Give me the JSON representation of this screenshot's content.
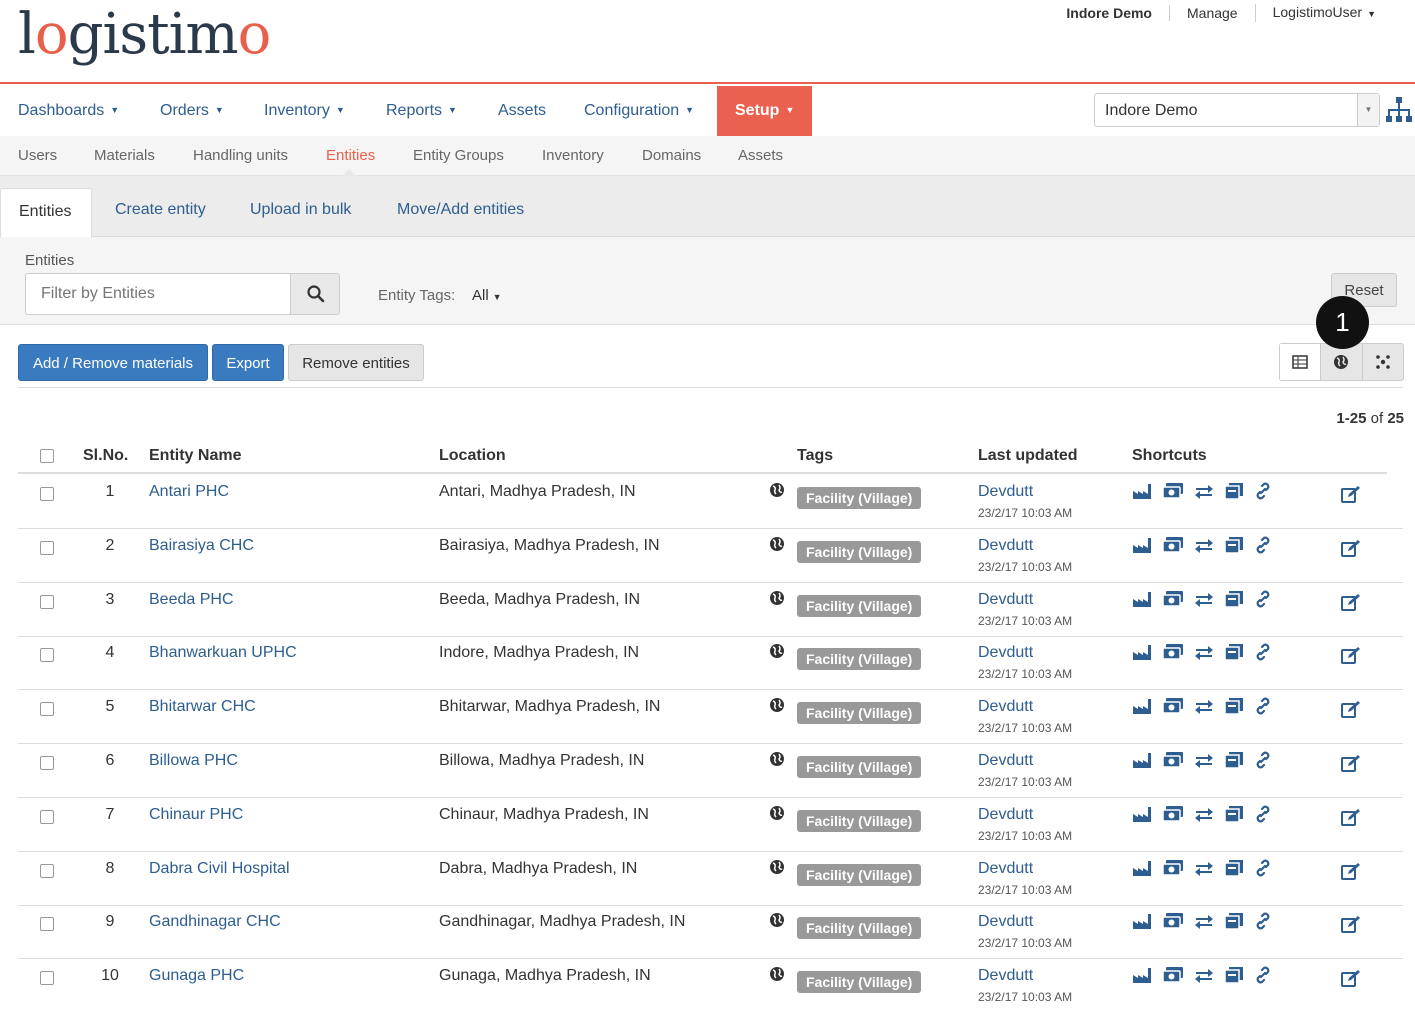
{
  "header": {
    "logo_pre": "l",
    "logo_o1": "o",
    "logo_mid": "gistim",
    "logo_o2": "o",
    "domain_link": "Indore Demo",
    "manage_link": "Manage",
    "user_menu": "LogistimoUser"
  },
  "main_nav": {
    "dashboards": "Dashboards",
    "orders": "Orders",
    "inventory": "Inventory",
    "reports": "Reports",
    "assets": "Assets",
    "configuration": "Configuration",
    "setup": "Setup",
    "domain_select": "Indore Demo"
  },
  "sub_nav": {
    "users": "Users",
    "materials": "Materials",
    "handling_units": "Handling units",
    "entities": "Entities",
    "entity_groups": "Entity Groups",
    "inventory": "Inventory",
    "domains": "Domains",
    "assets": "Assets"
  },
  "tabs": {
    "entities": "Entities",
    "create": "Create entity",
    "upload": "Upload in bulk",
    "move": "Move/Add entities"
  },
  "filter": {
    "label": "Entities",
    "placeholder": "Filter by Entities",
    "tags_label": "Entity Tags:",
    "tags_value": "All",
    "reset": "Reset"
  },
  "actions": {
    "add_remove": "Add / Remove materials",
    "export": "Export",
    "remove": "Remove entities",
    "badge": "1"
  },
  "pagination": {
    "range": "1-25",
    "of": "of",
    "total": "25"
  },
  "table": {
    "headers": {
      "slno": "Sl.No.",
      "name": "Entity Name",
      "location": "Location",
      "tags": "Tags",
      "updated": "Last updated",
      "shortcuts": "Shortcuts"
    },
    "rows": [
      {
        "no": "1",
        "name": "Antari PHC",
        "location": "Antari, Madhya Pradesh, IN",
        "tag": "Facility (Village)",
        "by": "Devdutt",
        "ts": "23/2/17 10:03 AM"
      },
      {
        "no": "2",
        "name": "Bairasiya CHC",
        "location": "Bairasiya, Madhya Pradesh, IN",
        "tag": "Facility (Village)",
        "by": "Devdutt",
        "ts": "23/2/17 10:03 AM"
      },
      {
        "no": "3",
        "name": "Beeda PHC",
        "location": "Beeda, Madhya Pradesh, IN",
        "tag": "Facility (Village)",
        "by": "Devdutt",
        "ts": "23/2/17 10:03 AM"
      },
      {
        "no": "4",
        "name": "Bhanwarkuan UPHC",
        "location": "Indore, Madhya Pradesh, IN",
        "tag": "Facility (Village)",
        "by": "Devdutt",
        "ts": "23/2/17 10:03 AM"
      },
      {
        "no": "5",
        "name": "Bhitarwar CHC",
        "location": "Bhitarwar, Madhya Pradesh, IN",
        "tag": "Facility (Village)",
        "by": "Devdutt",
        "ts": "23/2/17 10:03 AM"
      },
      {
        "no": "6",
        "name": "Billowa PHC",
        "location": "Billowa, Madhya Pradesh, IN",
        "tag": "Facility (Village)",
        "by": "Devdutt",
        "ts": "23/2/17 10:03 AM"
      },
      {
        "no": "7",
        "name": "Chinaur PHC",
        "location": "Chinaur, Madhya Pradesh, IN",
        "tag": "Facility (Village)",
        "by": "Devdutt",
        "ts": "23/2/17 10:03 AM"
      },
      {
        "no": "8",
        "name": "Dabra Civil Hospital",
        "location": "Dabra, Madhya Pradesh, IN",
        "tag": "Facility (Village)",
        "by": "Devdutt",
        "ts": "23/2/17 10:03 AM"
      },
      {
        "no": "9",
        "name": "Gandhinagar CHC",
        "location": "Gandhinagar, Madhya Pradesh, IN",
        "tag": "Facility (Village)",
        "by": "Devdutt",
        "ts": "23/2/17 10:03 AM"
      },
      {
        "no": "10",
        "name": "Gunaga PHC",
        "location": "Gunaga, Madhya Pradesh, IN",
        "tag": "Facility (Village)",
        "by": "Devdutt",
        "ts": "23/2/17 10:03 AM"
      }
    ]
  },
  "colors": {
    "accent": "#ea6150",
    "link": "#2e5d8f",
    "primary_button": "#3a7bbf"
  },
  "icons": {
    "shortcuts": [
      "factory-icon",
      "money-icon",
      "transfer-icon",
      "stock-icon",
      "link-icon"
    ],
    "row_globe": "globe-icon",
    "row_edit": "edit-icon"
  }
}
